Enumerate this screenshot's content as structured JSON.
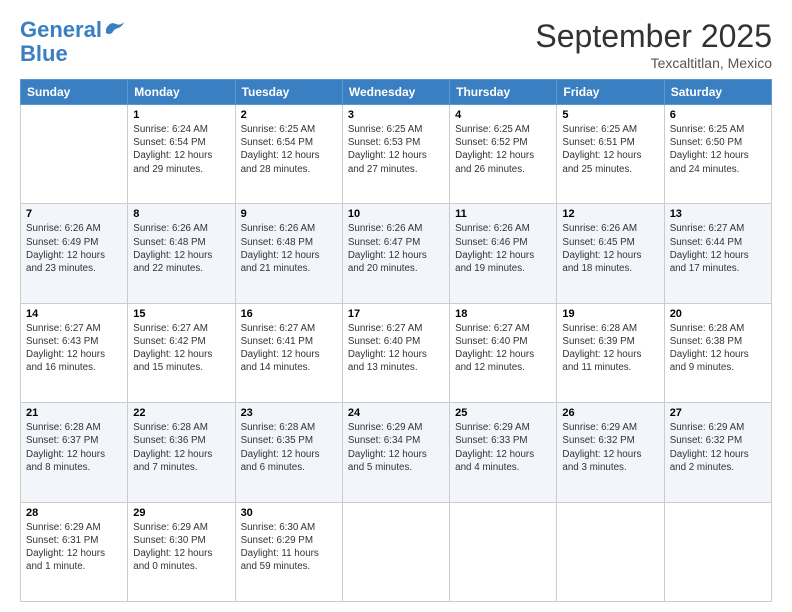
{
  "logo": {
    "line1": "General",
    "line2": "Blue"
  },
  "header": {
    "month": "September 2025",
    "location": "Texcaltitlan, Mexico"
  },
  "days_of_week": [
    "Sunday",
    "Monday",
    "Tuesday",
    "Wednesday",
    "Thursday",
    "Friday",
    "Saturday"
  ],
  "weeks": [
    [
      {
        "day": "",
        "info": ""
      },
      {
        "day": "1",
        "info": "Sunrise: 6:24 AM\nSunset: 6:54 PM\nDaylight: 12 hours\nand 29 minutes."
      },
      {
        "day": "2",
        "info": "Sunrise: 6:25 AM\nSunset: 6:54 PM\nDaylight: 12 hours\nand 28 minutes."
      },
      {
        "day": "3",
        "info": "Sunrise: 6:25 AM\nSunset: 6:53 PM\nDaylight: 12 hours\nand 27 minutes."
      },
      {
        "day": "4",
        "info": "Sunrise: 6:25 AM\nSunset: 6:52 PM\nDaylight: 12 hours\nand 26 minutes."
      },
      {
        "day": "5",
        "info": "Sunrise: 6:25 AM\nSunset: 6:51 PM\nDaylight: 12 hours\nand 25 minutes."
      },
      {
        "day": "6",
        "info": "Sunrise: 6:25 AM\nSunset: 6:50 PM\nDaylight: 12 hours\nand 24 minutes."
      }
    ],
    [
      {
        "day": "7",
        "info": "Sunrise: 6:26 AM\nSunset: 6:49 PM\nDaylight: 12 hours\nand 23 minutes."
      },
      {
        "day": "8",
        "info": "Sunrise: 6:26 AM\nSunset: 6:48 PM\nDaylight: 12 hours\nand 22 minutes."
      },
      {
        "day": "9",
        "info": "Sunrise: 6:26 AM\nSunset: 6:48 PM\nDaylight: 12 hours\nand 21 minutes."
      },
      {
        "day": "10",
        "info": "Sunrise: 6:26 AM\nSunset: 6:47 PM\nDaylight: 12 hours\nand 20 minutes."
      },
      {
        "day": "11",
        "info": "Sunrise: 6:26 AM\nSunset: 6:46 PM\nDaylight: 12 hours\nand 19 minutes."
      },
      {
        "day": "12",
        "info": "Sunrise: 6:26 AM\nSunset: 6:45 PM\nDaylight: 12 hours\nand 18 minutes."
      },
      {
        "day": "13",
        "info": "Sunrise: 6:27 AM\nSunset: 6:44 PM\nDaylight: 12 hours\nand 17 minutes."
      }
    ],
    [
      {
        "day": "14",
        "info": "Sunrise: 6:27 AM\nSunset: 6:43 PM\nDaylight: 12 hours\nand 16 minutes."
      },
      {
        "day": "15",
        "info": "Sunrise: 6:27 AM\nSunset: 6:42 PM\nDaylight: 12 hours\nand 15 minutes."
      },
      {
        "day": "16",
        "info": "Sunrise: 6:27 AM\nSunset: 6:41 PM\nDaylight: 12 hours\nand 14 minutes."
      },
      {
        "day": "17",
        "info": "Sunrise: 6:27 AM\nSunset: 6:40 PM\nDaylight: 12 hours\nand 13 minutes."
      },
      {
        "day": "18",
        "info": "Sunrise: 6:27 AM\nSunset: 6:40 PM\nDaylight: 12 hours\nand 12 minutes."
      },
      {
        "day": "19",
        "info": "Sunrise: 6:28 AM\nSunset: 6:39 PM\nDaylight: 12 hours\nand 11 minutes."
      },
      {
        "day": "20",
        "info": "Sunrise: 6:28 AM\nSunset: 6:38 PM\nDaylight: 12 hours\nand 9 minutes."
      }
    ],
    [
      {
        "day": "21",
        "info": "Sunrise: 6:28 AM\nSunset: 6:37 PM\nDaylight: 12 hours\nand 8 minutes."
      },
      {
        "day": "22",
        "info": "Sunrise: 6:28 AM\nSunset: 6:36 PM\nDaylight: 12 hours\nand 7 minutes."
      },
      {
        "day": "23",
        "info": "Sunrise: 6:28 AM\nSunset: 6:35 PM\nDaylight: 12 hours\nand 6 minutes."
      },
      {
        "day": "24",
        "info": "Sunrise: 6:29 AM\nSunset: 6:34 PM\nDaylight: 12 hours\nand 5 minutes."
      },
      {
        "day": "25",
        "info": "Sunrise: 6:29 AM\nSunset: 6:33 PM\nDaylight: 12 hours\nand 4 minutes."
      },
      {
        "day": "26",
        "info": "Sunrise: 6:29 AM\nSunset: 6:32 PM\nDaylight: 12 hours\nand 3 minutes."
      },
      {
        "day": "27",
        "info": "Sunrise: 6:29 AM\nSunset: 6:32 PM\nDaylight: 12 hours\nand 2 minutes."
      }
    ],
    [
      {
        "day": "28",
        "info": "Sunrise: 6:29 AM\nSunset: 6:31 PM\nDaylight: 12 hours\nand 1 minute."
      },
      {
        "day": "29",
        "info": "Sunrise: 6:29 AM\nSunset: 6:30 PM\nDaylight: 12 hours\nand 0 minutes."
      },
      {
        "day": "30",
        "info": "Sunrise: 6:30 AM\nSunset: 6:29 PM\nDaylight: 11 hours\nand 59 minutes."
      },
      {
        "day": "",
        "info": ""
      },
      {
        "day": "",
        "info": ""
      },
      {
        "day": "",
        "info": ""
      },
      {
        "day": "",
        "info": ""
      }
    ]
  ]
}
